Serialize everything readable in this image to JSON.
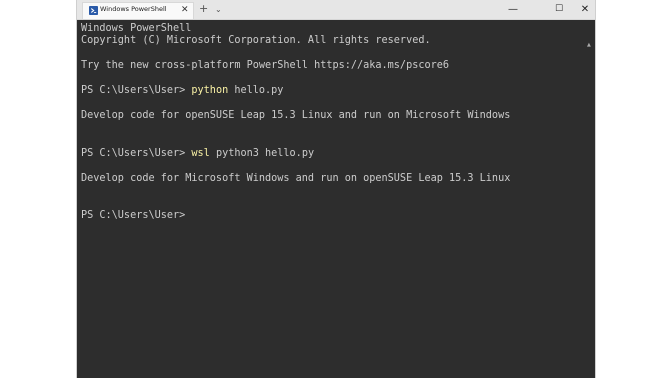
{
  "window": {
    "tab_title": "Windows PowerShell",
    "tab_close": "✕",
    "new_tab": "+",
    "dropdown": "⌄",
    "minimize": "—",
    "maximize": "☐",
    "close": "✕"
  },
  "console": {
    "header_line1": "Windows PowerShell",
    "header_line2": "Copyright (C) Microsoft Corporation. All rights reserved.",
    "try_line": "Try the new cross-platform PowerShell https://aka.ms/pscore6",
    "prompt1": "PS C:\\Users\\User> ",
    "cmd1": "python",
    "args1": " hello.py",
    "output1": "Develop code for openSUSE Leap 15.3 Linux and run on Microsoft Windows",
    "prompt2": "PS C:\\Users\\User> ",
    "cmd2": "wsl",
    "args2": " python3 hello.py",
    "output2": "Develop code for Microsoft Windows and run on openSUSE Leap 15.3 Linux",
    "prompt3": "PS C:\\Users\\User>"
  }
}
